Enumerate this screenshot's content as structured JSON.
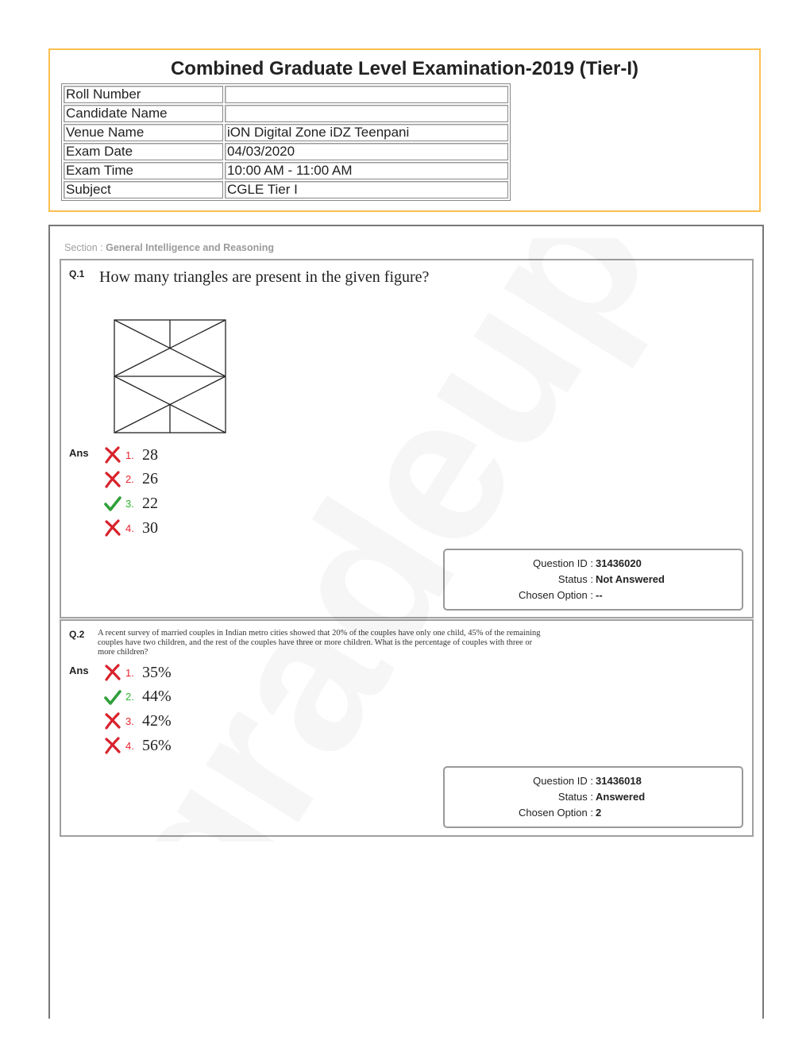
{
  "header": {
    "title": "Combined Graduate Level Examination-2019 (Tier-I)",
    "rows": [
      {
        "label": "Roll Number",
        "value": ""
      },
      {
        "label": "Candidate Name",
        "value": ""
      },
      {
        "label": "Venue Name",
        "value": "iON Digital Zone iDZ Teenpani"
      },
      {
        "label": "Exam Date",
        "value": "04/03/2020"
      },
      {
        "label": "Exam Time",
        "value": "10:00 AM - 11:00 AM"
      },
      {
        "label": "Subject",
        "value": "CGLE Tier I"
      }
    ]
  },
  "section": {
    "prefix": "Section : ",
    "name": "General Intelligence and Reasoning"
  },
  "questions": [
    {
      "number": "Q.1",
      "text": "How many triangles are present in the given figure?",
      "ans_label": "Ans",
      "options": [
        {
          "num": "1.",
          "value": "28",
          "correct": false,
          "icon": "cross-icon"
        },
        {
          "num": "2.",
          "value": "26",
          "correct": false,
          "icon": "cross-icon"
        },
        {
          "num": "3.",
          "value": "22",
          "correct": true,
          "icon": "check-icon"
        },
        {
          "num": "4.",
          "value": "30",
          "correct": false,
          "icon": "cross-icon"
        }
      ],
      "status": {
        "id_label": "Question ID :",
        "id": "31436020",
        "status_label": "Status :",
        "status": "Not Answered",
        "chosen_label": "Chosen Option :",
        "chosen": "--"
      }
    },
    {
      "number": "Q.2",
      "text": "A recent survey of married couples in Indian metro cities showed that 20% of the couples have only one child, 45% of the remaining couples have two children, and the rest of the couples have three or more children. What is the percentage of couples with three or more children?",
      "ans_label": "Ans",
      "options": [
        {
          "num": "1.",
          "value": "35%",
          "correct": false,
          "icon": "cross-icon"
        },
        {
          "num": "2.",
          "value": "44%",
          "correct": true,
          "icon": "check-icon"
        },
        {
          "num": "3.",
          "value": "42%",
          "correct": false,
          "icon": "cross-icon"
        },
        {
          "num": "4.",
          "value": "56%",
          "correct": false,
          "icon": "cross-icon"
        }
      ],
      "status": {
        "id_label": "Question ID :",
        "id": "31436018",
        "status_label": "Status :",
        "status": "Answered",
        "chosen_label": "Chosen Option :",
        "chosen": "2"
      }
    }
  ],
  "watermark": "gradeup",
  "colors": {
    "header_border": "#fbbf50",
    "wrong": "#e8232f",
    "right": "#2db52d"
  }
}
